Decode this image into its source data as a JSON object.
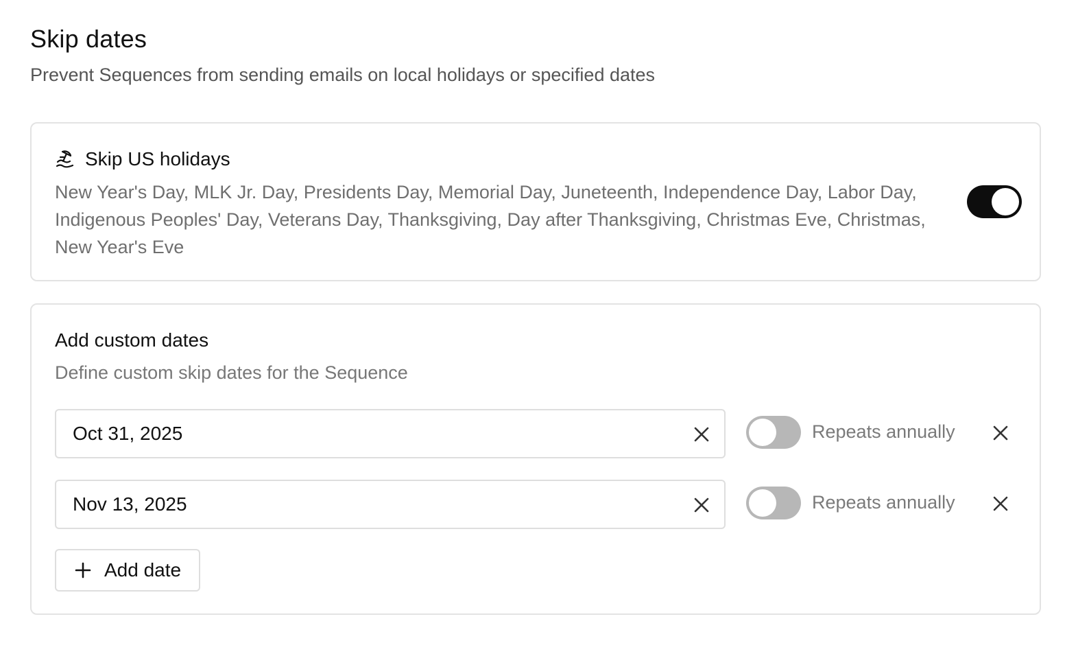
{
  "header": {
    "title": "Skip dates",
    "subtitle": "Prevent Sequences from sending emails on local holidays or specified dates"
  },
  "holidays": {
    "icon": "beach-umbrella-icon",
    "title": "Skip US holidays",
    "list": "New Year's Day, MLK Jr. Day, Presidents Day, Memorial Day, Juneteenth, Independence Day, Labor Day, Indigenous Peoples' Day, Veterans Day, Thanksgiving, Day after Thanksgiving, Christmas Eve, Christmas, New Year's Eve",
    "enabled": true
  },
  "custom": {
    "title": "Add custom dates",
    "subtitle": "Define custom skip dates for the Sequence",
    "dates": [
      {
        "value": "Oct 31, 2025",
        "repeat_label": "Repeats annually",
        "repeats": false
      },
      {
        "value": "Nov 13, 2025",
        "repeat_label": "Repeats annually",
        "repeats": false
      }
    ],
    "add_label": "Add date"
  },
  "colors": {
    "toggle_on": "#0d0d0d",
    "toggle_off": "#b7b7b7",
    "border": "#e3e3e3"
  }
}
